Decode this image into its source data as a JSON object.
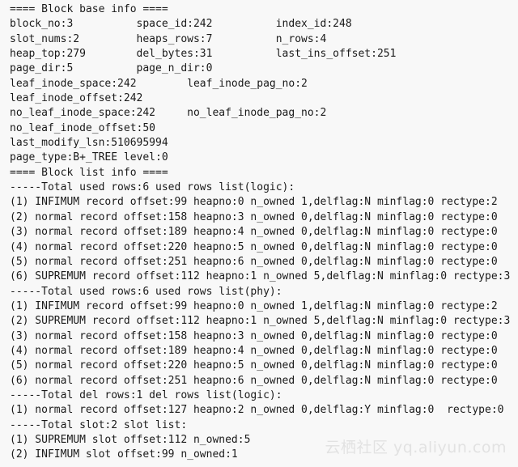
{
  "lines": [
    "==== Block base info ====",
    "block_no:3          space_id:242          index_id:248",
    "slot_nums:2         heaps_rows:7          n_rows:4",
    "heap_top:279        del_bytes:31          last_ins_offset:251",
    "page_dir:5          page_n_dir:0",
    "leaf_inode_space:242        leaf_inode_pag_no:2",
    "leaf_inode_offset:242",
    "no_leaf_inode_space:242     no_leaf_inode_pag_no:2",
    "no_leaf_inode_offset:50",
    "last_modify_lsn:510695994",
    "page_type:B+_TREE level:0",
    "==== Block list info ====",
    "-----Total used rows:6 used rows list(logic):",
    "(1) INFIMUM record offset:99 heapno:0 n_owned 1,delflag:N minflag:0 rectype:2",
    "(2) normal record offset:158 heapno:3 n_owned 0,delflag:N minflag:0 rectype:0",
    "(3) normal record offset:189 heapno:4 n_owned 0,delflag:N minflag:0 rectype:0",
    "(4) normal record offset:220 heapno:5 n_owned 0,delflag:N minflag:0 rectype:0",
    "(5) normal record offset:251 heapno:6 n_owned 0,delflag:N minflag:0 rectype:0",
    "(6) SUPREMUM record offset:112 heapno:1 n_owned 5,delflag:N minflag:0 rectype:3",
    "-----Total used rows:6 used rows list(phy):",
    "(1) INFIMUM record offset:99 heapno:0 n_owned 1,delflag:N minflag:0 rectype:2",
    "(2) SUPREMUM record offset:112 heapno:1 n_owned 5,delflag:N minflag:0 rectype:3",
    "(3) normal record offset:158 heapno:3 n_owned 0,delflag:N minflag:0 rectype:0",
    "(4) normal record offset:189 heapno:4 n_owned 0,delflag:N minflag:0 rectype:0",
    "(5) normal record offset:220 heapno:5 n_owned 0,delflag:N minflag:0 rectype:0",
    "(6) normal record offset:251 heapno:6 n_owned 0,delflag:N minflag:0 rectype:0",
    "-----Total del rows:1 del rows list(logic):",
    "(1) normal record offset:127 heapno:2 n_owned 0,delflag:Y minflag:0  rectype:0",
    "-----Total slot:2 slot list:",
    "(1) SUPREMUM slot offset:112 n_owned:5",
    "(2) INFIMUM slot offset:99 n_owned:1"
  ],
  "watermark": "云栖社区 yq.aliyun.com"
}
